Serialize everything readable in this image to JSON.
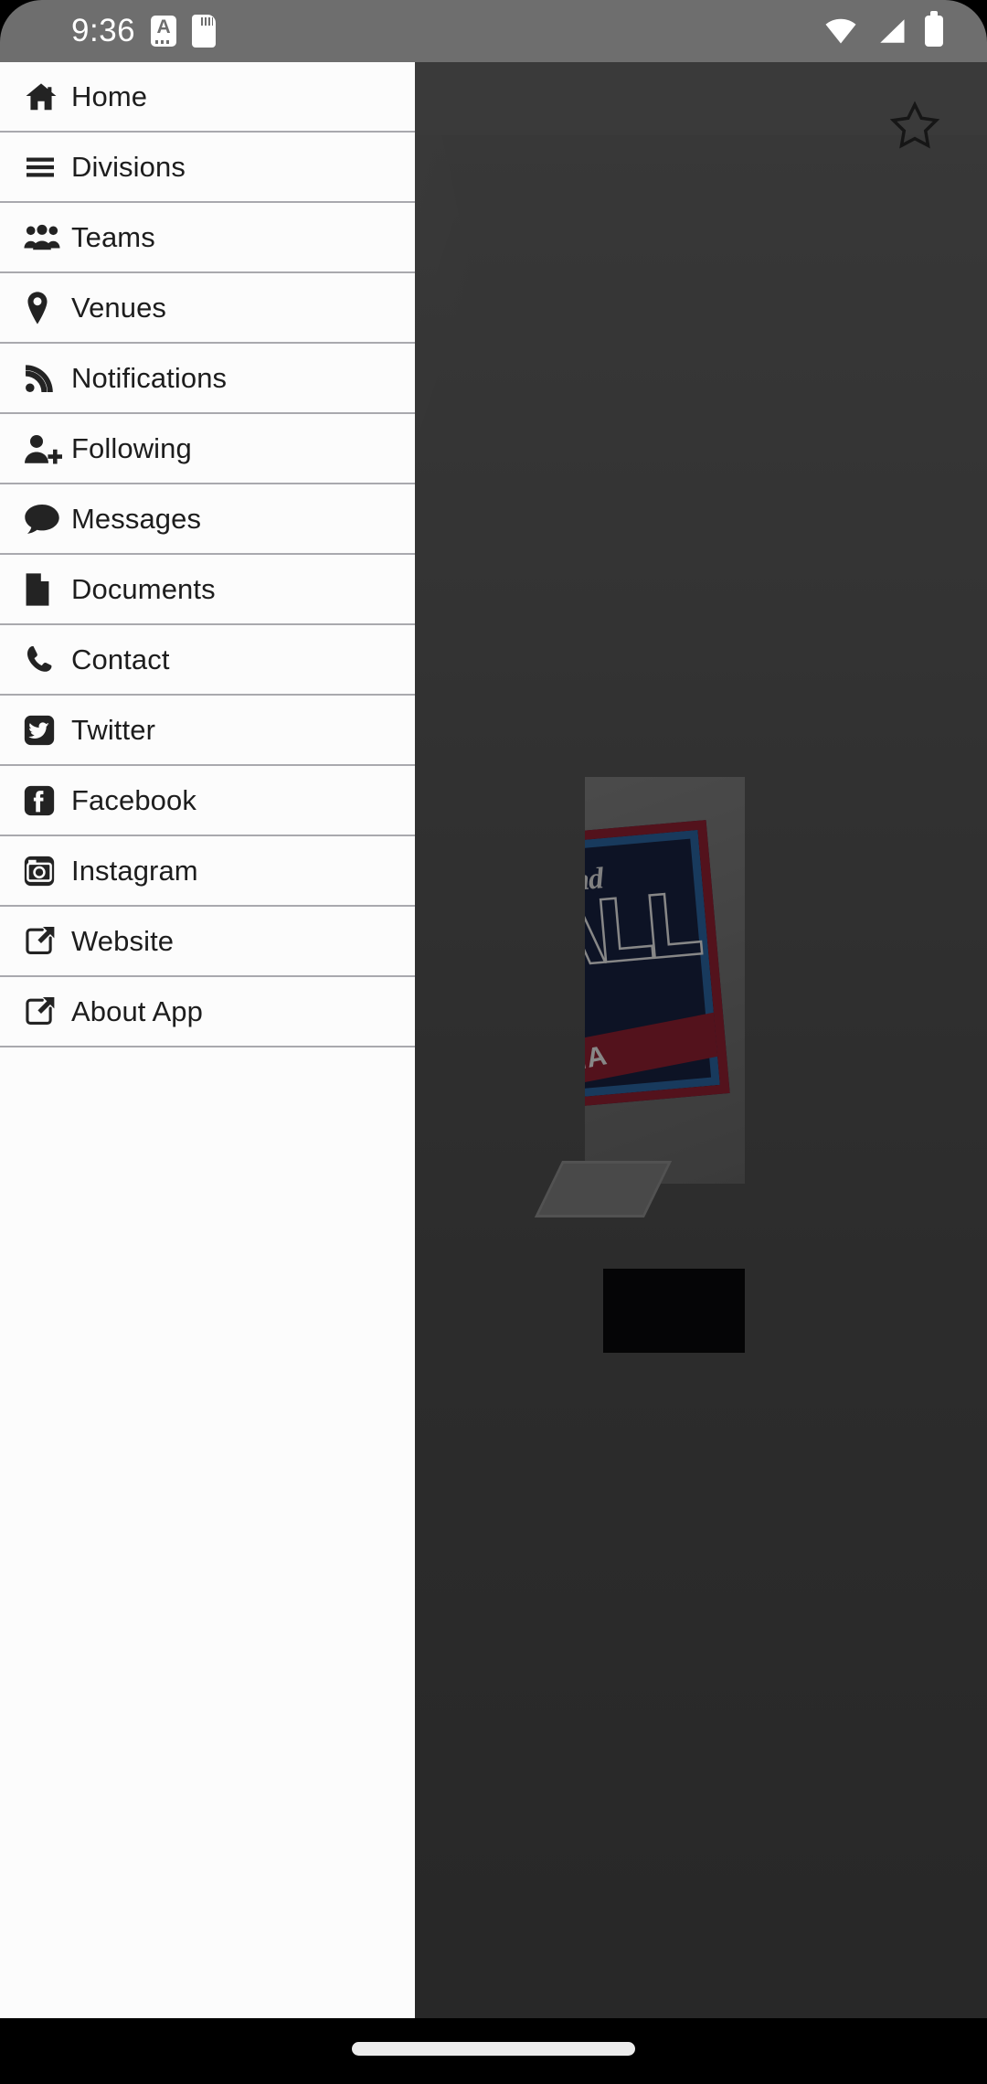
{
  "status_bar": {
    "time": "9:36",
    "alarm_badge_letter": "A",
    "icons": [
      "alarm-badge-icon",
      "sd-card-icon",
      "wifi-icon",
      "cellular-signal-icon",
      "battery-icon"
    ]
  },
  "drawer": {
    "items": [
      {
        "label": "Home",
        "icon": "home-icon"
      },
      {
        "label": "Divisions",
        "icon": "list-icon"
      },
      {
        "label": "Teams",
        "icon": "users-icon"
      },
      {
        "label": "Venues",
        "icon": "map-pin-icon"
      },
      {
        "label": "Notifications",
        "icon": "rss-feed-icon"
      },
      {
        "label": "Following",
        "icon": "user-plus-icon"
      },
      {
        "label": "Messages",
        "icon": "chat-bubble-icon"
      },
      {
        "label": "Documents",
        "icon": "document-icon"
      },
      {
        "label": "Contact",
        "icon": "phone-icon"
      },
      {
        "label": "Twitter",
        "icon": "twitter-icon"
      },
      {
        "label": "Facebook",
        "icon": "facebook-icon"
      },
      {
        "label": "Instagram",
        "icon": "instagram-icon"
      },
      {
        "label": "Website",
        "icon": "external-link-icon"
      },
      {
        "label": "About App",
        "icon": "external-link-icon"
      }
    ]
  },
  "background_app": {
    "favorite_icon": "star-outline-icon",
    "logo": {
      "script_text": "ekend",
      "main_text": "ALL",
      "sub_text": "ONA",
      "colors": {
        "red": "#9d2235",
        "blue": "#2f6fb0",
        "navy": "#1a2546"
      }
    }
  },
  "navigation_bar": {
    "handle": "gesture-pill"
  },
  "colors": {
    "drawer_background": "#fcfcfc",
    "divider": "#a9a9ae",
    "status_bar": "#6e6e6e",
    "text": "#1d1d1d",
    "nav_bar": "#000000"
  }
}
